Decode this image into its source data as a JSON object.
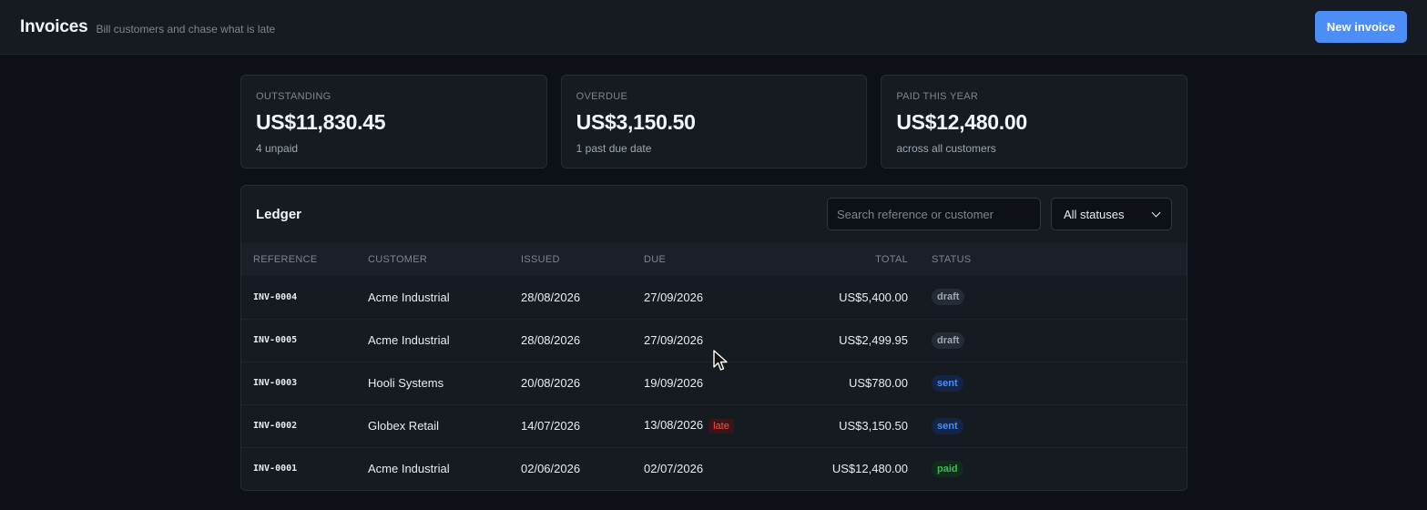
{
  "header": {
    "title": "Invoices",
    "subtitle": "Bill customers and chase what is late",
    "new_button": "New invoice"
  },
  "stats": [
    {
      "label": "OUTSTANDING",
      "value": "US$11,830.45",
      "note": "4 unpaid"
    },
    {
      "label": "OVERDUE",
      "value": "US$3,150.50",
      "note": "1 past due date"
    },
    {
      "label": "PAID THIS YEAR",
      "value": "US$12,480.00",
      "note": "across all customers"
    }
  ],
  "ledger": {
    "title": "Ledger",
    "search_placeholder": "Search reference or customer",
    "status_filter": "All statuses",
    "columns": {
      "reference": "REFERENCE",
      "customer": "CUSTOMER",
      "issued": "ISSUED",
      "due": "DUE",
      "total": "TOTAL",
      "status": "STATUS"
    },
    "rows": [
      {
        "reference": "INV-0004",
        "customer": "Acme Industrial",
        "issued": "28/08/2026",
        "due": "27/09/2026",
        "late": "",
        "total": "US$5,400.00",
        "status": "draft"
      },
      {
        "reference": "INV-0005",
        "customer": "Acme Industrial",
        "issued": "28/08/2026",
        "due": "27/09/2026",
        "late": "",
        "total": "US$2,499.95",
        "status": "draft"
      },
      {
        "reference": "INV-0003",
        "customer": "Hooli Systems",
        "issued": "20/08/2026",
        "due": "19/09/2026",
        "late": "",
        "total": "US$780.00",
        "status": "sent"
      },
      {
        "reference": "INV-0002",
        "customer": "Globex Retail",
        "issued": "14/07/2026",
        "due": "13/08/2026",
        "late": "late",
        "total": "US$3,150.50",
        "status": "sent"
      },
      {
        "reference": "INV-0001",
        "customer": "Acme Industrial",
        "issued": "02/06/2026",
        "due": "02/07/2026",
        "late": "",
        "total": "US$12,480.00",
        "status": "paid"
      }
    ]
  },
  "colors": {
    "accent": "#4c8df6",
    "background": "#0d1117",
    "card": "#161b22",
    "draft": "#9da7b3",
    "sent": "#4c8df6",
    "paid": "#3fb950",
    "late": "#f85149"
  }
}
